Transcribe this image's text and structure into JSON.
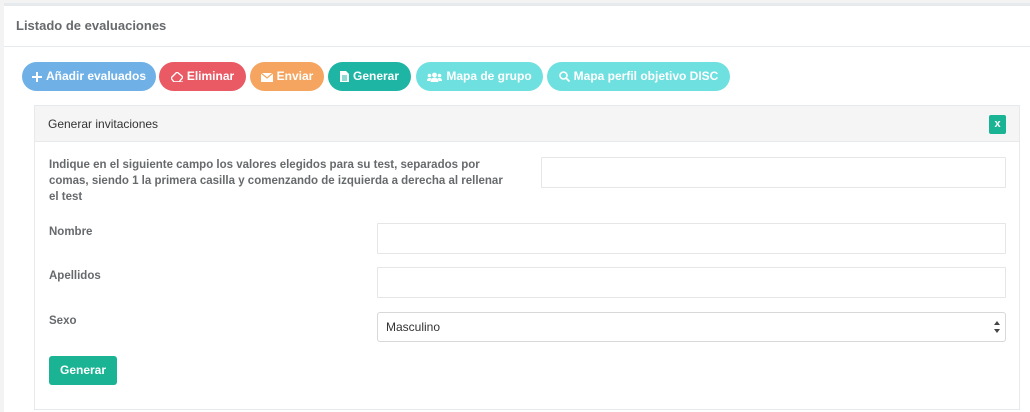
{
  "panel": {
    "title": "Listado de evaluaciones"
  },
  "toolbar": {
    "add": "Añadir evaluados",
    "delete": "Eliminar",
    "send": "Enviar",
    "generate": "Generar",
    "group_map": "Mapa de grupo",
    "disc_map": "Mapa perfil objetivo DISC"
  },
  "invitations": {
    "title": "Generar invitaciones",
    "close": "x",
    "values_label": "Indique en el siguiente campo los valores elegidos para su test, separados por comas, siendo 1 la primera casilla y comenzando de izquierda a derecha al rellenar el test",
    "values_value": "",
    "name_label": "Nombre",
    "name_value": "",
    "surname_label": "Apellidos",
    "surname_value": "",
    "sex_label": "Sexo",
    "sex_value": "Masculino",
    "submit": "Generar"
  },
  "colors": {
    "add": "#6fb1e6",
    "delete": "#ea5a64",
    "send": "#f5a55f",
    "generate": "#1fb5a5",
    "map": "#6fe0e0",
    "primary": "#1ab394"
  }
}
